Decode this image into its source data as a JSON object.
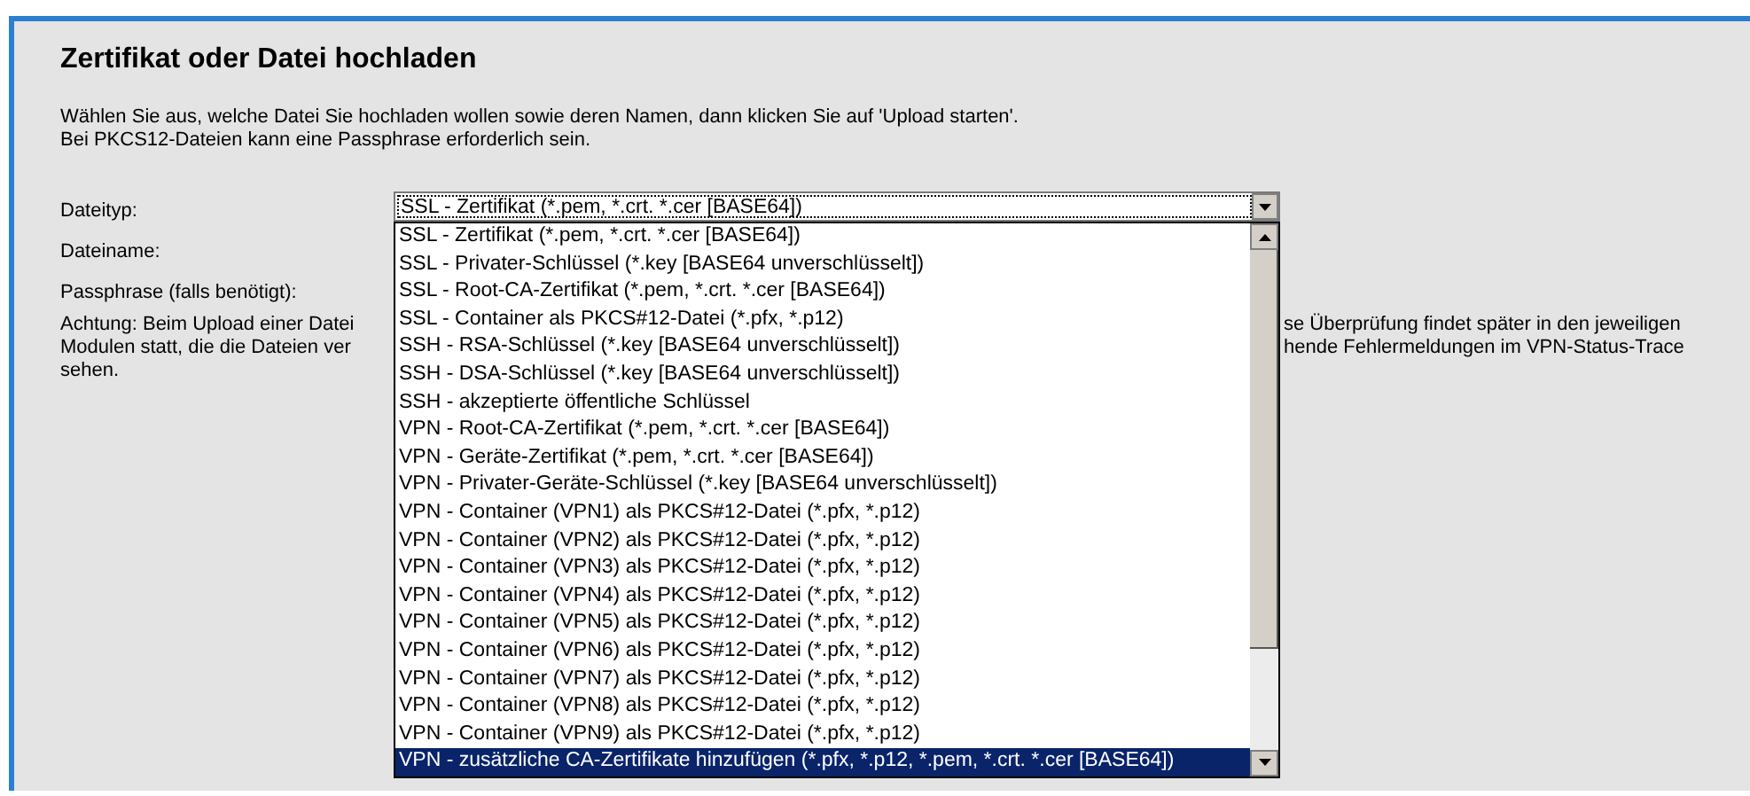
{
  "title": "Zertifikat oder Datei hochladen",
  "intro": [
    "Wählen Sie aus, welche Datei Sie hochladen wollen sowie deren Namen, dann klicken Sie auf 'Upload starten'.",
    "Bei PKCS12-Dateien kann eine Passphrase erforderlich sein."
  ],
  "form": {
    "file_type_label": "Dateityp:",
    "file_type_value": "SSL - Zertifikat (*.pem, *.crt. *.cer [BASE64])",
    "file_name_label": "Dateiname:",
    "passphrase_label": "Passphrase (falls benötigt):"
  },
  "warning": {
    "left_lines": [
      "Achtung: Beim Upload einer Datei",
      "Modulen statt, die die Dateien ver",
      "sehen."
    ],
    "right_lines": [
      "se Überprüfung findet später in den jeweiligen",
      "hende Fehlermeldungen im VPN-Status-Trace"
    ]
  },
  "dropdown": {
    "expanded": true,
    "options": [
      {
        "label": "SSL - Zertifikat (*.pem, *.crt. *.cer [BASE64])",
        "selected": false
      },
      {
        "label": "SSL - Privater-Schlüssel (*.key [BASE64 unverschlüsselt])",
        "selected": false
      },
      {
        "label": "SSL - Root-CA-Zertifikat (*.pem, *.crt. *.cer [BASE64])",
        "selected": false
      },
      {
        "label": "SSL - Container als PKCS#12-Datei (*.pfx, *.p12)",
        "selected": false
      },
      {
        "label": "SSH - RSA-Schlüssel (*.key [BASE64 unverschlüsselt])",
        "selected": false
      },
      {
        "label": "SSH - DSA-Schlüssel (*.key [BASE64 unverschlüsselt])",
        "selected": false
      },
      {
        "label": "SSH - akzeptierte öffentliche Schlüssel",
        "selected": false
      },
      {
        "label": "VPN - Root-CA-Zertifikat (*.pem, *.crt. *.cer [BASE64])",
        "selected": false
      },
      {
        "label": "VPN - Geräte-Zertifikat (*.pem, *.crt. *.cer [BASE64])",
        "selected": false
      },
      {
        "label": "VPN - Privater-Geräte-Schlüssel (*.key [BASE64 unverschlüsselt])",
        "selected": false
      },
      {
        "label": "VPN - Container (VPN1) als PKCS#12-Datei (*.pfx, *.p12)",
        "selected": false
      },
      {
        "label": "VPN - Container (VPN2) als PKCS#12-Datei (*.pfx, *.p12)",
        "selected": false
      },
      {
        "label": "VPN - Container (VPN3) als PKCS#12-Datei (*.pfx, *.p12)",
        "selected": false
      },
      {
        "label": "VPN - Container (VPN4) als PKCS#12-Datei (*.pfx, *.p12)",
        "selected": false
      },
      {
        "label": "VPN - Container (VPN5) als PKCS#12-Datei (*.pfx, *.p12)",
        "selected": false
      },
      {
        "label": "VPN - Container (VPN6) als PKCS#12-Datei (*.pfx, *.p12)",
        "selected": false
      },
      {
        "label": "VPN - Container (VPN7) als PKCS#12-Datei (*.pfx, *.p12)",
        "selected": false
      },
      {
        "label": "VPN - Container (VPN8) als PKCS#12-Datei (*.pfx, *.p12)",
        "selected": false
      },
      {
        "label": "VPN - Container (VPN9) als PKCS#12-Datei (*.pfx, *.p12)",
        "selected": false
      },
      {
        "label": "VPN - zusätzliche CA-Zertifikate hinzufügen (*.pfx, *.p12, *.pem, *.crt. *.cer [BASE64])",
        "selected": true
      }
    ]
  }
}
